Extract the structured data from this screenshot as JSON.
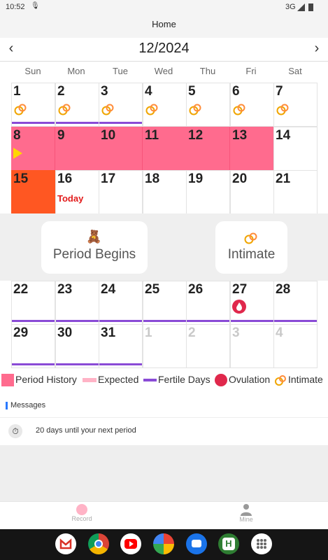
{
  "status": {
    "time": "10:52",
    "network": "3G"
  },
  "app": {
    "title": "Home"
  },
  "month": {
    "label": "12/2024",
    "prev_icon": "chevron-left-icon",
    "next_icon": "chevron-right-icon"
  },
  "weekdays": [
    "Sun",
    "Mon",
    "Tue",
    "Wed",
    "Thu",
    "Fri",
    "Sat"
  ],
  "calendar": {
    "today_label": "Today",
    "rows": [
      [
        "1",
        "2",
        "3",
        "4",
        "5",
        "6",
        "7"
      ],
      [
        "8",
        "9",
        "10",
        "11",
        "12",
        "13",
        "14"
      ],
      [
        "15",
        "16",
        "17",
        "18",
        "19",
        "20",
        "21"
      ],
      [
        "22",
        "23",
        "24",
        "25",
        "26",
        "27",
        "28"
      ],
      [
        "29",
        "30",
        "31",
        "1",
        "2",
        "3",
        "4"
      ]
    ]
  },
  "actions": {
    "period_begins": "Period Begins",
    "intimate": "Intimate"
  },
  "legend": {
    "period_history": "Period History",
    "expected": "Expected",
    "fertile_days": "Fertile Days",
    "ovulation": "Ovulation",
    "intimate": "Intimate"
  },
  "messages": {
    "header": "Messages",
    "text": "20 days until your next period"
  },
  "nav": {
    "record": "Record",
    "mine": "Mine"
  },
  "colors": {
    "period": "#ff6b8e",
    "period_start": "#ff5722",
    "expected": "#ffb3c6",
    "fertile": "#8a4bd6",
    "ovulation": "#e0284c",
    "today": "#e21b1b"
  },
  "dock_apps": [
    "gmail-icon",
    "chrome-icon",
    "youtube-icon",
    "photos-icon",
    "messages-icon",
    "h-app-icon",
    "app-drawer-icon"
  ]
}
